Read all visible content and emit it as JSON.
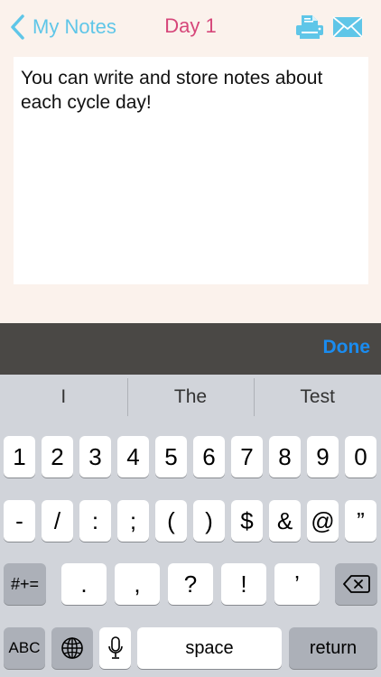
{
  "nav": {
    "back_label": "My Notes",
    "title": "Day 1",
    "print_icon": "printer-icon",
    "mail_icon": "envelope-icon"
  },
  "note": {
    "text": "You can write and store notes about each cycle day!"
  },
  "accessory": {
    "done_label": "Done"
  },
  "keyboard": {
    "suggestions": [
      "I",
      "The",
      "Test"
    ],
    "row1": [
      "1",
      "2",
      "3",
      "4",
      "5",
      "6",
      "7",
      "8",
      "9",
      "0"
    ],
    "row2": [
      "-",
      "/",
      ":",
      ";",
      "(",
      ")",
      "$",
      "&",
      "@",
      "”"
    ],
    "row3_left": "#+=",
    "row3": [
      ".",
      ",",
      "?",
      "!",
      "’"
    ],
    "backspace_icon": "backspace-icon",
    "abc_label": "ABC",
    "globe_icon": "globe-icon",
    "mic_icon": "microphone-icon",
    "space_label": "space",
    "return_label": "return"
  },
  "colors": {
    "back": "#5fc6e8",
    "title": "#d6477a",
    "done": "#1a8cf0",
    "background": "#fbf2ec"
  }
}
